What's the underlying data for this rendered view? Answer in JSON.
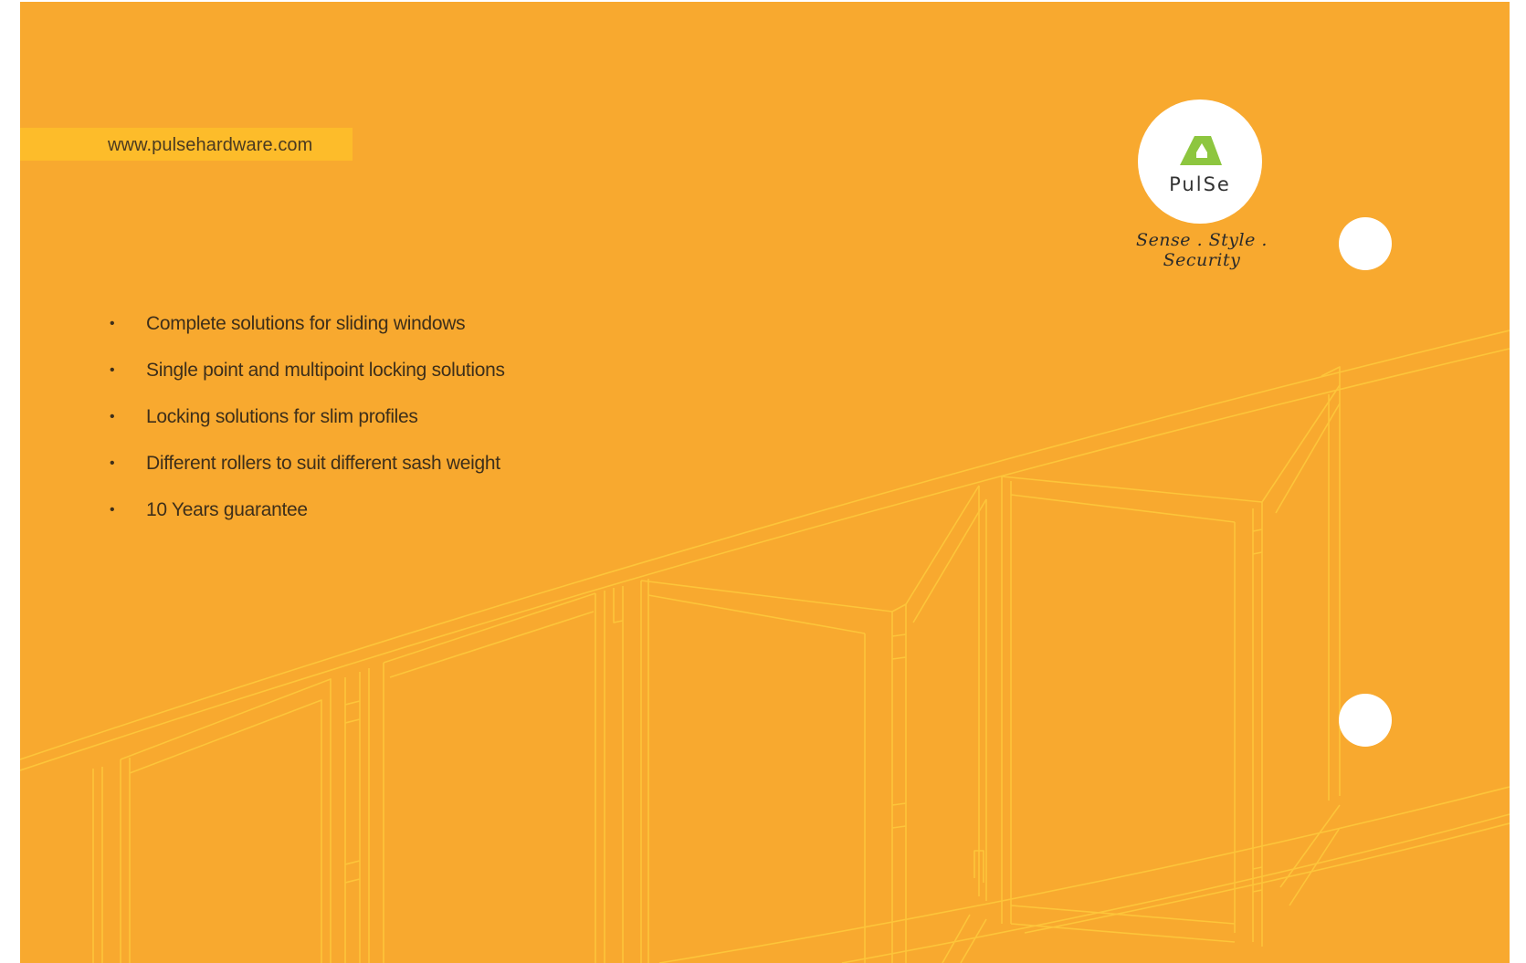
{
  "brochure": {
    "website": "www.pulsehardware.com",
    "brand": {
      "logo_icon": "pulse-logo-mark",
      "logo_word": "PulSe",
      "tagline": "Sense . Style . Security",
      "accent_color": "#8dc63f"
    },
    "features": [
      "Complete solutions for sliding windows",
      "Single point and multipoint locking solutions",
      "Locking solutions for slim profiles",
      "Different rollers to suit different sash weight",
      "10 Years guarantee"
    ],
    "colors": {
      "background": "#f8a92f",
      "url_band": "#fdbc2a",
      "text": "#3e2f1a",
      "line_art": "#fdc53a"
    }
  }
}
